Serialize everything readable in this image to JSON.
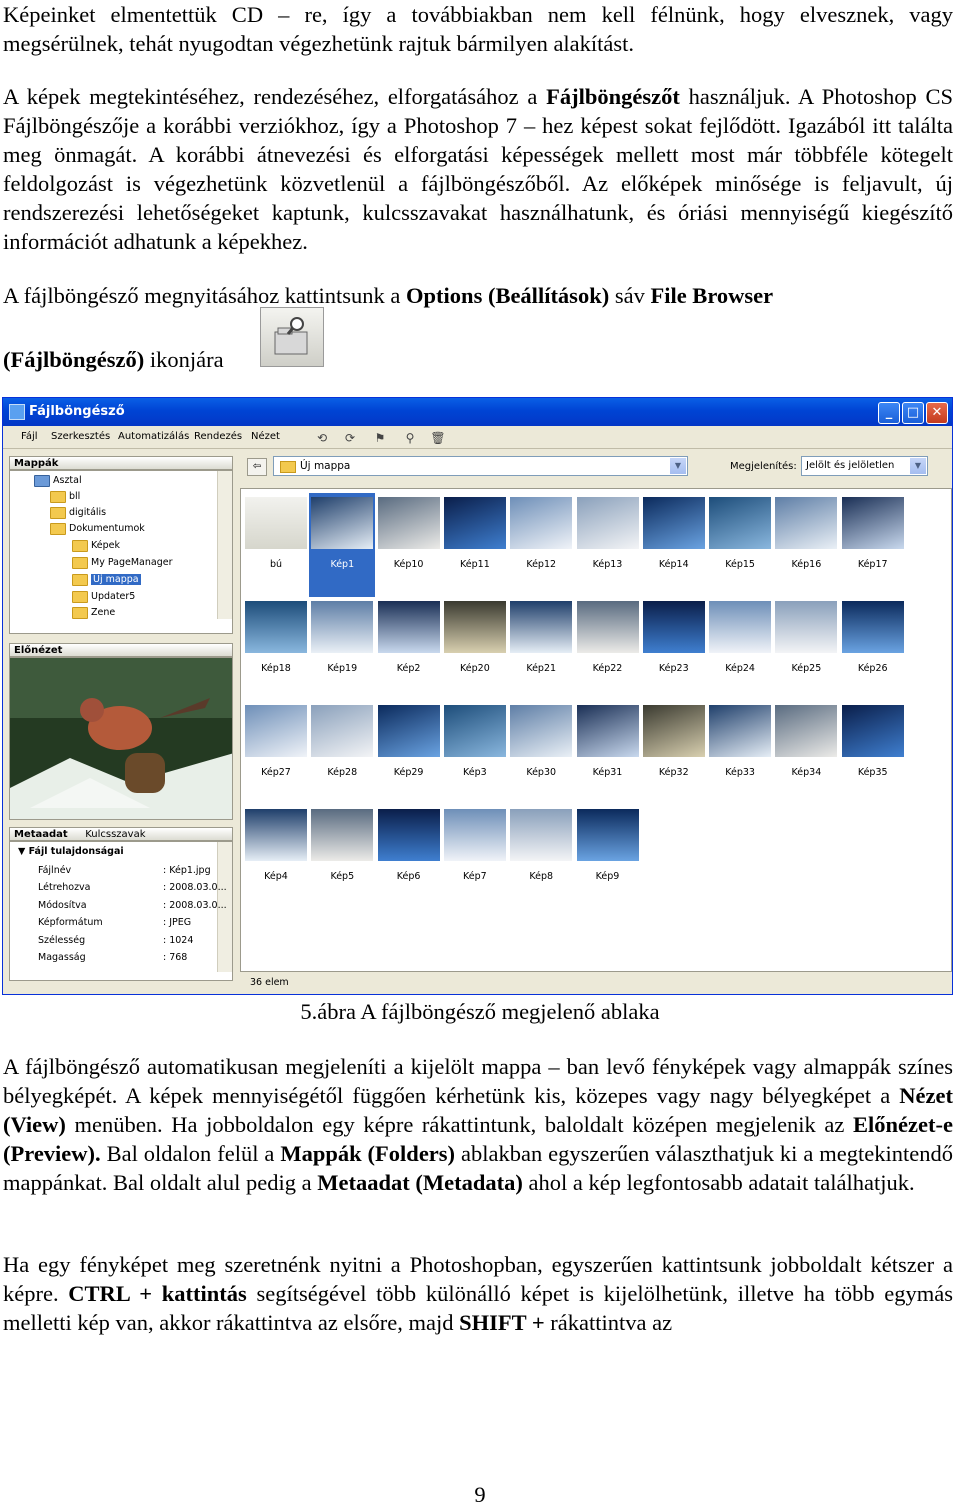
{
  "paragraphs": {
    "p1": "Képeinket elmentettük CD – re, így a továbbiakban nem kell félnünk, hogy elvesznek, vagy megsérülnek, tehát nyugodtan végezhetünk rajtuk bármilyen alakítást.",
    "p2_a": "A képek megtekintéséhez, rendezéséhez, elforgatásához a ",
    "p2_b": "Fájlböngészőt",
    "p2_c": " használjuk. A Photoshop CS Fájlböngészője a korábbi verziókhoz, így a Photoshop 7 – hez képest sokat fejlődött. Igazából itt találta meg önmagát. A korábbi átnevezési és elforgatási képességek mellett most már többféle kötegelt feldolgozást is végezhetünk közvetlenül a fájlböngészőből. Az előképek minősége is feljavult, új rendszerezési lehetőségeket kaptunk, kulcsszavakat használhatunk, és óriási mennyiségű kiegészítő információt adhatunk a képekhez.",
    "p3_a": "A fájlböngésző megnyitásához kattintsunk a ",
    "p3_b": "Options (Beállítások)",
    "p3_c": " sáv ",
    "p3_d": "File Browser",
    "p3_e": "(Fájlböngésző)",
    "p3_f": " ikonjára",
    "p4_a": "A fájlböngésző automatikusan megjeleníti a kijelölt mappa – ban levő fényképek vagy almappák színes bélyegképét. A képek mennyiségétől függően kérhetünk kis, közepes vagy nagy bélyegképet a ",
    "p4_b": "Nézet (View)",
    "p4_c": " menüben. Ha jobboldalon egy képre rákattintunk, baloldalt középen megjelenik az ",
    "p4_d": "Előnézet-e (Preview).",
    "p4_e": " Bal oldalon felül a ",
    "p4_f": "Mappák (Folders)",
    "p4_g": " ablakban egyszerűen választhatjuk ki a megtekintendő mappánkat. Bal oldalt alul pedig a ",
    "p4_h": "Metaadat (Metadata)",
    "p4_i": " ahol a kép legfontosabb adatait találhatjuk.",
    "p5_a": "Ha egy fényképet meg szeretnénk nyitni a Photoshopban, egyszerűen kattintsunk jobboldalt kétszer a képre. ",
    "p5_b": "CTRL + kattintás",
    "p5_c": " segítségével több különálló képet is kijelölhetünk, illetve ha több egymás melletti kép van, akkor rákattintva az elsőre, majd ",
    "p5_d": "SHIFT +",
    "p5_e": " rákattintva az"
  },
  "caption": "5.ábra A fájlböngésző megjelenő ablaka",
  "page_number": "9",
  "window": {
    "title": "Fájlböngésző",
    "buttons": {
      "minimize": "_",
      "maximize": "□",
      "close": "✕"
    },
    "menus": [
      "Fájl",
      "Szerkesztés",
      "Automatizálás",
      "Rendezés",
      "Nézet"
    ],
    "folders_tab": "Mappák",
    "tree": [
      "Asztal",
      "bll",
      "digitális",
      "Dokumentumok",
      "Képek",
      "My PageManager",
      "Új mappa",
      "Updater5",
      "Zene"
    ],
    "preview_tab": "Előnézet",
    "metadata_tab": "Metaadat",
    "keywords_tab": "Kulcsszavak",
    "file_props_header": "Fájl tulajdonságai",
    "metadata": [
      {
        "key": "Fájlnév",
        "value": ": Kép1.jpg"
      },
      {
        "key": "Létrehozva",
        "value": ": 2008.03.0..."
      },
      {
        "key": "Módosítva",
        "value": ": 2008.03.0..."
      },
      {
        "key": "Képformátum",
        "value": ": JPEG"
      },
      {
        "key": "Szélesség",
        "value": ": 1024"
      },
      {
        "key": "Magasság",
        "value": ": 768"
      }
    ],
    "address": "Új mappa",
    "view_label": "Megjelenítés:",
    "view_value": "Jelölt és jelöletlen",
    "thumbnails": [
      "bú",
      "Kép1",
      "Kép10",
      "Kép11",
      "Kép12",
      "Kép13",
      "Kép14",
      "Kép15",
      "Kép16",
      "Kép17",
      "Kép18",
      "Kép19",
      "Kép2",
      "Kép20",
      "Kép21",
      "Kép22",
      "Kép23",
      "Kép24",
      "Kép25",
      "Kép26",
      "Kép27",
      "Kép28",
      "Kép29",
      "Kép3",
      "Kép30",
      "Kép31",
      "Kép32",
      "Kép33",
      "Kép34",
      "Kép35",
      "Kép4",
      "Kép5",
      "Kép6",
      "Kép7",
      "Kép8",
      "Kép9"
    ],
    "selected_thumbnail": "Kép1",
    "status_count": "36 elem"
  }
}
